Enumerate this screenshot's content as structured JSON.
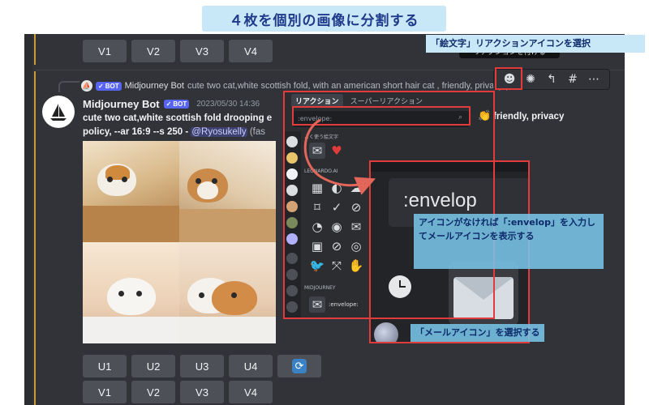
{
  "title_banner": "４枚を個別の画像に分割する",
  "top_buttons": [
    "V1",
    "V2",
    "V3",
    "V4"
  ],
  "reply": {
    "bot_tag": "BOT",
    "author": "Midjourney Bot",
    "text": "cute two cat,white scottish fold, with an american short hair cat , friendly, privacy po..."
  },
  "message": {
    "author": "Midjourney Bot",
    "bot_tag": "BOT",
    "timestamp": "2023/05/30 14:36",
    "line1": "cute two cat,white scottish fold drooping e",
    "right_text": "friendly, privacy",
    "line2": "policy, --ar 16:9 --s 250 - ",
    "mention": "@Ryosukelly",
    "tail": " (fas"
  },
  "bottom_buttons_u": [
    "U1",
    "U2",
    "U3",
    "U4"
  ],
  "bottom_buttons_v": [
    "V1",
    "V2",
    "V3",
    "V4"
  ],
  "tooltip": "リアクションを付ける",
  "picker": {
    "tab_active": "リアクション",
    "tab_other": "スーパーリアクション",
    "search_value": ":envelope:",
    "section_frequent": "よく使う絵文字",
    "section_leonardo": "LEONARDO.AI",
    "section_midjourney": "MIDJOURNEY",
    "result_label": ":envelope:"
  },
  "zoom": {
    "text": ":envelop"
  },
  "callouts": {
    "top": "「絵文字」リアクションアイコンを選択",
    "mid": "アイコンがなければ「:envelop」を入力してメールアイコンを表示する",
    "bottom": "「メールアイコン」を選択する"
  },
  "colors": {
    "discord_bg": "#313338",
    "button": "#4e5058",
    "highlight": "#e23b3b",
    "callout": "#78c4e6",
    "bot_tag": "#5865f2"
  }
}
